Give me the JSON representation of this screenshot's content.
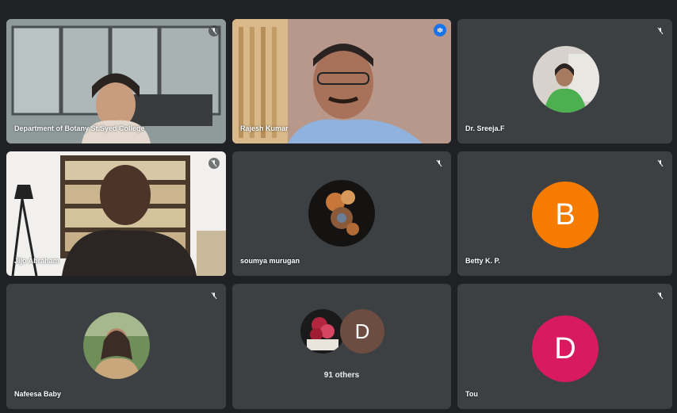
{
  "participants": [
    {
      "name": "Department of Botany St.Syed College"
    },
    {
      "name": "Rajesh Kumar"
    },
    {
      "name": "Dr. Sreeja.F"
    },
    {
      "name": "Jijo Abraham"
    },
    {
      "name": "soumya murugan"
    },
    {
      "name": "Betty K. P.",
      "initial": "B"
    },
    {
      "name": "Nafeesa Baby"
    },
    {
      "others_label": "91 others",
      "initial": "D"
    },
    {
      "name": "Tou",
      "initial": "D"
    }
  ],
  "colors": {
    "background": "#202124",
    "tile": "#3c4043",
    "active_border": "#8ab4f8",
    "speaking": "#1a73e8",
    "avatar_orange": "#f57c00",
    "avatar_pink": "#d81b60",
    "avatar_brown": "#6d4c41"
  }
}
